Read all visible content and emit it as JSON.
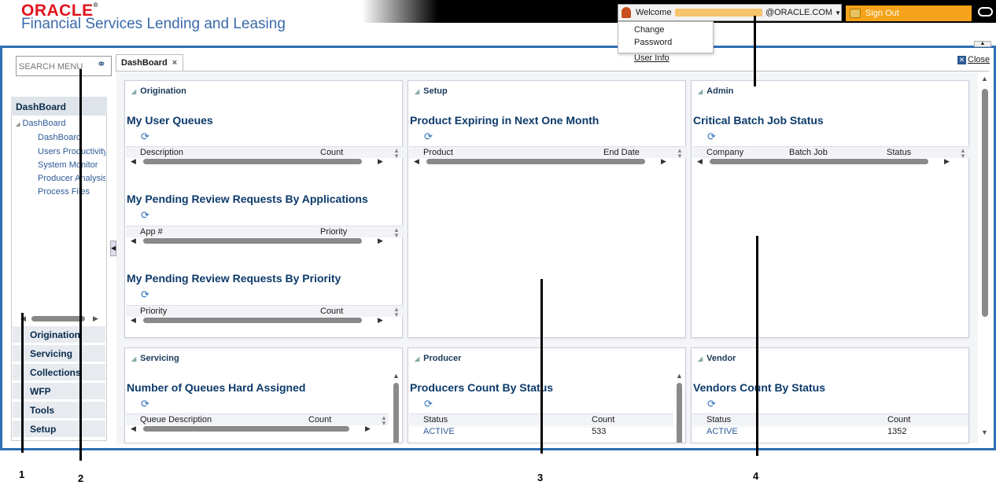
{
  "header": {
    "logo_oracle": "ORACLE",
    "logo_product": "Financial Services Lending and Leasing",
    "welcome_label": "Welcome",
    "email_suffix": "@ORACLE.COM",
    "signout_label": "Sign Out"
  },
  "user_menu": {
    "items": [
      "Change Password",
      "User Info"
    ]
  },
  "search": {
    "placeholder": "SEARCH MENU"
  },
  "sidebar": {
    "header": "DashBoard",
    "tree_root": "DashBoard",
    "tree_items": [
      "DashBoard",
      "Users Productivity",
      "System Monitor",
      "Producer Analysis",
      "Process Files"
    ],
    "nav_items": [
      "Origination",
      "Servicing",
      "Collections",
      "WFP",
      "Tools",
      "Setup"
    ]
  },
  "tab": {
    "label": "DashBoard",
    "close_label": "Close"
  },
  "panels": {
    "origination": {
      "title": "Origination",
      "sections": [
        {
          "title": "My User Queues",
          "col1": "Description",
          "col2": "Count"
        },
        {
          "title": "My Pending Review Requests By Applications",
          "col1": "App #",
          "col2": "Priority"
        },
        {
          "title": "My Pending Review Requests By Priority",
          "col1": "Priority",
          "col2": "Count"
        }
      ]
    },
    "setup": {
      "title": "Setup",
      "section": {
        "title": "Product Expiring in Next One Month",
        "col1": "Product",
        "col2": "End Date"
      }
    },
    "admin": {
      "title": "Admin",
      "section": {
        "title": "Critical Batch Job Status",
        "col1": "Company",
        "col2": "Batch Job",
        "col3": "Status"
      }
    },
    "servicing": {
      "title": "Servicing",
      "section": {
        "title": "Number of Queues Hard Assigned",
        "col1": "Queue Description",
        "col2": "Count"
      }
    },
    "producer": {
      "title": "Producer",
      "section": {
        "title": "Producers Count By Status",
        "col1": "Status",
        "col2": "Count"
      },
      "rows": [
        {
          "status": "ACTIVE",
          "count": "533"
        }
      ]
    },
    "vendor": {
      "title": "Vendor",
      "section": {
        "title": "Vendors Count By Status",
        "col1": "Status",
        "col2": "Count"
      },
      "rows": [
        {
          "status": "ACTIVE",
          "count": "1352"
        }
      ]
    }
  },
  "annotations": [
    "1",
    "2",
    "3",
    "4"
  ],
  "colors": {
    "frame_blue": "#2e6db5",
    "signout_orange": "#f5a31a",
    "oracle_red": "#e0141c"
  }
}
